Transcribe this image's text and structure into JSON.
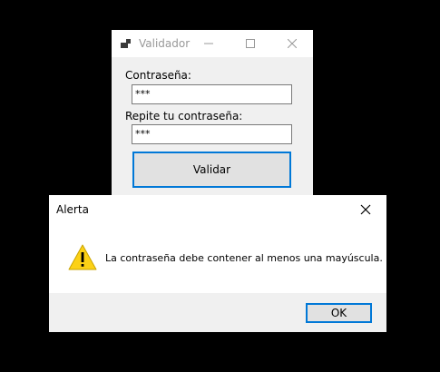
{
  "main_window": {
    "title": "Validador",
    "icon": "app-form-icon",
    "controls": {
      "minimize": "minimize-icon",
      "maximize": "maximize-icon",
      "close": "close-icon"
    },
    "password_label": "Contraseña:",
    "password_value": "***",
    "repeat_label": "Repite tu contraseña:",
    "repeat_value": "***",
    "validate_button": "Validar"
  },
  "alert_dialog": {
    "title": "Alerta",
    "icon": "warning-icon",
    "message": "La contraseña debe contener al menos una mayúscula.",
    "ok_button": "OK"
  },
  "colors": {
    "background": "#000000",
    "window_bg": "#f0f0f0",
    "titlebar_bg": "#ffffff",
    "accent": "#0078d7",
    "button_face": "#e1e1e1",
    "warning": "#fcd116"
  }
}
